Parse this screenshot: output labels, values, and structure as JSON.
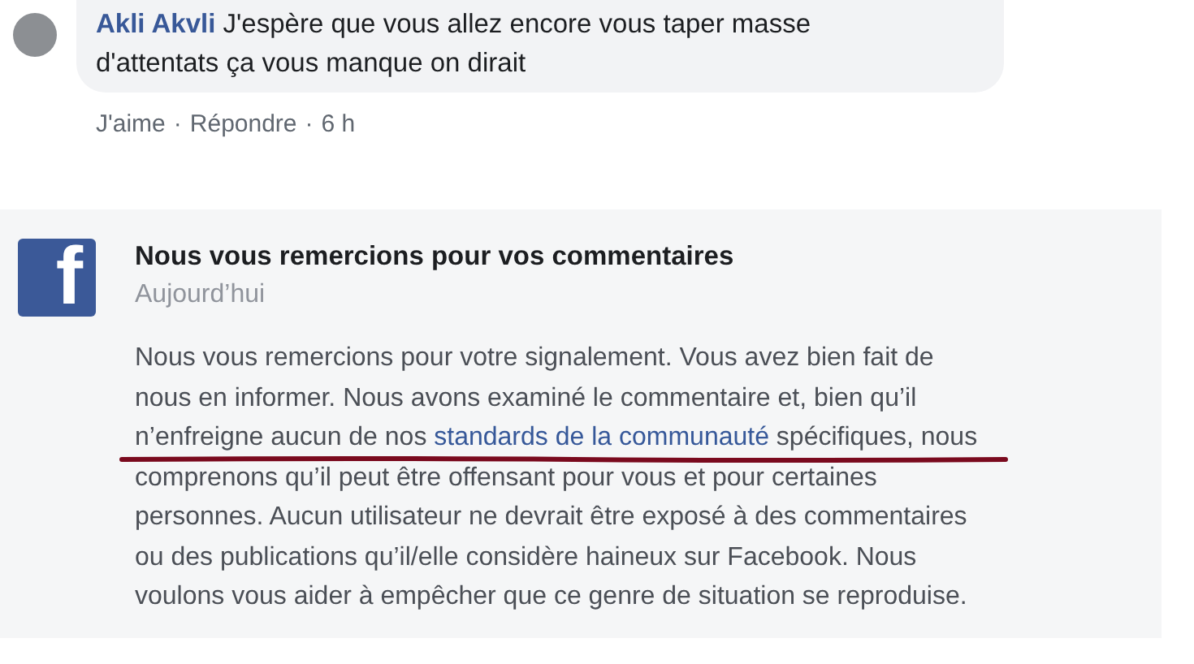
{
  "comment": {
    "author": "Akli Akvli",
    "text": "J'espère que vous allez encore vous taper masse",
    "text_line_2": "d'attentats ça vous manque on dirait",
    "separator": "·",
    "actions": [
      "J'aime",
      "Répondre",
      "6 h"
    ]
  },
  "notice": {
    "logo": "f",
    "title": "Nous vous remercions pour vos commentaires",
    "date": "Aujourd’hui",
    "body_before": "Nous vous remercions pour votre signalement. Vous avez bien fait de\nnous en informer. Nous avons examiné le commentaire et, bien qu’il\nn’enfreigne aucun de nos ",
    "link": "standards de la communauté",
    "body_after": " spécifiques, nous",
    "body_rest": "comprenons qu’il peut être offensant pour vous et pour certaines\npersonnes. Aucun utilisateur ne devrait être exposé à des commentaires\nou des publications qu’il/elle considère haineux sur Facebook. Nous\nvoulons vous aider à empêcher que ce genre de situation se reproduise."
  }
}
